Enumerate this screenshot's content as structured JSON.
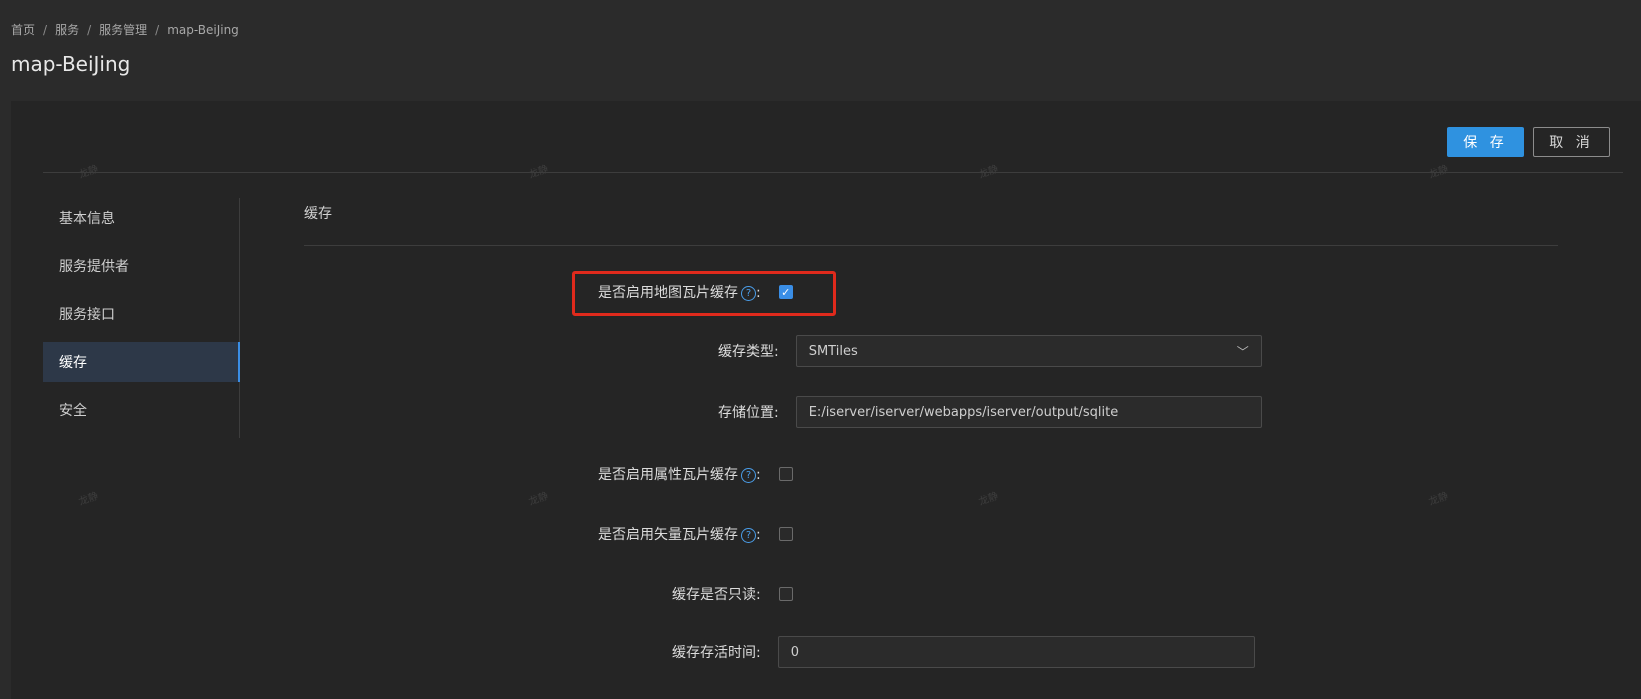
{
  "breadcrumb": [
    "首页",
    "服务",
    "服务管理",
    "map-BeiJing"
  ],
  "breadcrumb_separator": "/",
  "page_title": "map-BeiJing",
  "toolbar": {
    "save_label": "保 存",
    "cancel_label": "取 消"
  },
  "sidebar": {
    "items": [
      {
        "label": "基本信息",
        "active": false
      },
      {
        "label": "服务提供者",
        "active": false
      },
      {
        "label": "服务接口",
        "active": false
      },
      {
        "label": "缓存",
        "active": true
      },
      {
        "label": "安全",
        "active": false
      }
    ]
  },
  "section": {
    "title": "缓存"
  },
  "form": {
    "enable_map_tile_cache": {
      "label": "是否启用地图瓦片缓存",
      "suffix": ":",
      "checked": true
    },
    "cache_type": {
      "label": "缓存类型",
      "suffix": ":",
      "value": "SMTiles"
    },
    "storage_location": {
      "label": "存储位置",
      "suffix": ":",
      "value": "E:/iserver/iserver/webapps/iserver/output/sqlite"
    },
    "enable_attribute_tile_cache": {
      "label": "是否启用属性瓦片缓存",
      "suffix": ":",
      "checked": false
    },
    "enable_vector_tile_cache": {
      "label": "是否启用矢量瓦片缓存",
      "suffix": ":",
      "checked": false
    },
    "cache_readonly": {
      "label": "缓存是否只读",
      "suffix": ":",
      "checked": false
    },
    "cache_ttl": {
      "label": "缓存存活时间",
      "suffix": ":",
      "value": "0"
    }
  },
  "icons": {
    "help": "question-circle-icon",
    "checkmark": "check-icon",
    "dropdown": "chevron-down-icon"
  },
  "watermark": "龙静",
  "colors": {
    "accent": "#2f92e0",
    "highlight_border": "#e02a1c",
    "background": "#2b2b2b"
  }
}
